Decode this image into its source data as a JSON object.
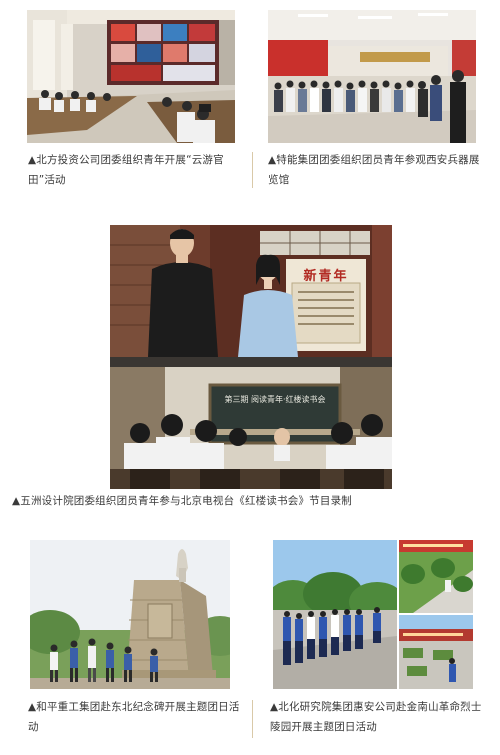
{
  "captions": {
    "top_left": "▲北方投资公司团委组织青年开展“云游官田”活动",
    "top_right": "▲特能集团团委组织团员青年参观西安兵器展览馆",
    "middle": "▲五洲设计院团委组织团员青年参与北京电视台《红楼读书会》节目录制",
    "bottom_left": "▲和平重工集团赴东北纪念碑开展主题团日活动",
    "bottom_right": "▲北化研究院集团惠安公司赴金南山革命烈士陵园开展主题团日活动"
  },
  "photo_text": {
    "newspaper_title": "新青年",
    "blackboard_text": "第三期 阅读青年·红楼读书会"
  },
  "colors": {
    "divider": "#d9c9a8",
    "caption_text": "#3a3a3a"
  }
}
